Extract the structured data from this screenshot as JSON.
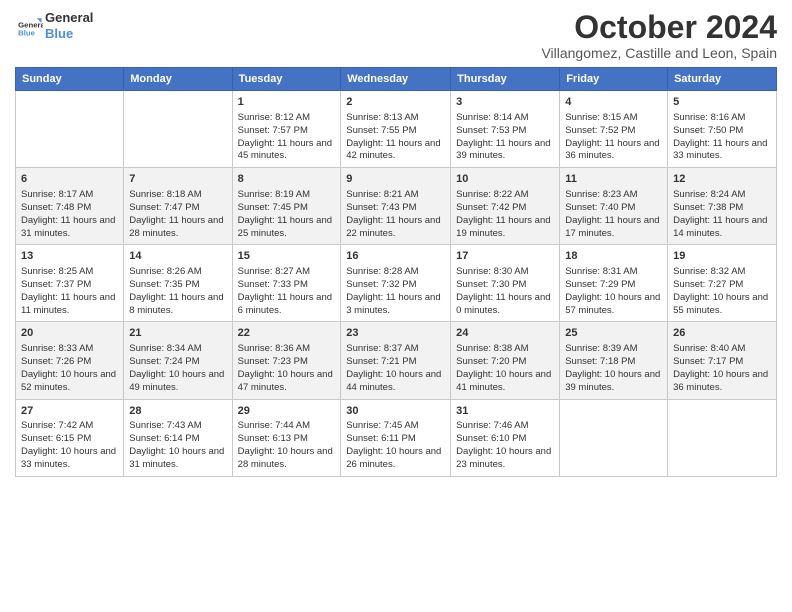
{
  "header": {
    "logo": {
      "line1": "General",
      "line2": "Blue"
    },
    "title": "October 2024",
    "subtitle": "Villangomez, Castille and Leon, Spain"
  },
  "days_of_week": [
    "Sunday",
    "Monday",
    "Tuesday",
    "Wednesday",
    "Thursday",
    "Friday",
    "Saturday"
  ],
  "weeks": [
    [
      {
        "day": "",
        "sunrise": "",
        "sunset": "",
        "daylight": ""
      },
      {
        "day": "",
        "sunrise": "",
        "sunset": "",
        "daylight": ""
      },
      {
        "day": "1",
        "sunrise": "Sunrise: 8:12 AM",
        "sunset": "Sunset: 7:57 PM",
        "daylight": "Daylight: 11 hours and 45 minutes."
      },
      {
        "day": "2",
        "sunrise": "Sunrise: 8:13 AM",
        "sunset": "Sunset: 7:55 PM",
        "daylight": "Daylight: 11 hours and 42 minutes."
      },
      {
        "day": "3",
        "sunrise": "Sunrise: 8:14 AM",
        "sunset": "Sunset: 7:53 PM",
        "daylight": "Daylight: 11 hours and 39 minutes."
      },
      {
        "day": "4",
        "sunrise": "Sunrise: 8:15 AM",
        "sunset": "Sunset: 7:52 PM",
        "daylight": "Daylight: 11 hours and 36 minutes."
      },
      {
        "day": "5",
        "sunrise": "Sunrise: 8:16 AM",
        "sunset": "Sunset: 7:50 PM",
        "daylight": "Daylight: 11 hours and 33 minutes."
      }
    ],
    [
      {
        "day": "6",
        "sunrise": "Sunrise: 8:17 AM",
        "sunset": "Sunset: 7:48 PM",
        "daylight": "Daylight: 11 hours and 31 minutes."
      },
      {
        "day": "7",
        "sunrise": "Sunrise: 8:18 AM",
        "sunset": "Sunset: 7:47 PM",
        "daylight": "Daylight: 11 hours and 28 minutes."
      },
      {
        "day": "8",
        "sunrise": "Sunrise: 8:19 AM",
        "sunset": "Sunset: 7:45 PM",
        "daylight": "Daylight: 11 hours and 25 minutes."
      },
      {
        "day": "9",
        "sunrise": "Sunrise: 8:21 AM",
        "sunset": "Sunset: 7:43 PM",
        "daylight": "Daylight: 11 hours and 22 minutes."
      },
      {
        "day": "10",
        "sunrise": "Sunrise: 8:22 AM",
        "sunset": "Sunset: 7:42 PM",
        "daylight": "Daylight: 11 hours and 19 minutes."
      },
      {
        "day": "11",
        "sunrise": "Sunrise: 8:23 AM",
        "sunset": "Sunset: 7:40 PM",
        "daylight": "Daylight: 11 hours and 17 minutes."
      },
      {
        "day": "12",
        "sunrise": "Sunrise: 8:24 AM",
        "sunset": "Sunset: 7:38 PM",
        "daylight": "Daylight: 11 hours and 14 minutes."
      }
    ],
    [
      {
        "day": "13",
        "sunrise": "Sunrise: 8:25 AM",
        "sunset": "Sunset: 7:37 PM",
        "daylight": "Daylight: 11 hours and 11 minutes."
      },
      {
        "day": "14",
        "sunrise": "Sunrise: 8:26 AM",
        "sunset": "Sunset: 7:35 PM",
        "daylight": "Daylight: 11 hours and 8 minutes."
      },
      {
        "day": "15",
        "sunrise": "Sunrise: 8:27 AM",
        "sunset": "Sunset: 7:33 PM",
        "daylight": "Daylight: 11 hours and 6 minutes."
      },
      {
        "day": "16",
        "sunrise": "Sunrise: 8:28 AM",
        "sunset": "Sunset: 7:32 PM",
        "daylight": "Daylight: 11 hours and 3 minutes."
      },
      {
        "day": "17",
        "sunrise": "Sunrise: 8:30 AM",
        "sunset": "Sunset: 7:30 PM",
        "daylight": "Daylight: 11 hours and 0 minutes."
      },
      {
        "day": "18",
        "sunrise": "Sunrise: 8:31 AM",
        "sunset": "Sunset: 7:29 PM",
        "daylight": "Daylight: 10 hours and 57 minutes."
      },
      {
        "day": "19",
        "sunrise": "Sunrise: 8:32 AM",
        "sunset": "Sunset: 7:27 PM",
        "daylight": "Daylight: 10 hours and 55 minutes."
      }
    ],
    [
      {
        "day": "20",
        "sunrise": "Sunrise: 8:33 AM",
        "sunset": "Sunset: 7:26 PM",
        "daylight": "Daylight: 10 hours and 52 minutes."
      },
      {
        "day": "21",
        "sunrise": "Sunrise: 8:34 AM",
        "sunset": "Sunset: 7:24 PM",
        "daylight": "Daylight: 10 hours and 49 minutes."
      },
      {
        "day": "22",
        "sunrise": "Sunrise: 8:36 AM",
        "sunset": "Sunset: 7:23 PM",
        "daylight": "Daylight: 10 hours and 47 minutes."
      },
      {
        "day": "23",
        "sunrise": "Sunrise: 8:37 AM",
        "sunset": "Sunset: 7:21 PM",
        "daylight": "Daylight: 10 hours and 44 minutes."
      },
      {
        "day": "24",
        "sunrise": "Sunrise: 8:38 AM",
        "sunset": "Sunset: 7:20 PM",
        "daylight": "Daylight: 10 hours and 41 minutes."
      },
      {
        "day": "25",
        "sunrise": "Sunrise: 8:39 AM",
        "sunset": "Sunset: 7:18 PM",
        "daylight": "Daylight: 10 hours and 39 minutes."
      },
      {
        "day": "26",
        "sunrise": "Sunrise: 8:40 AM",
        "sunset": "Sunset: 7:17 PM",
        "daylight": "Daylight: 10 hours and 36 minutes."
      }
    ],
    [
      {
        "day": "27",
        "sunrise": "Sunrise: 7:42 AM",
        "sunset": "Sunset: 6:15 PM",
        "daylight": "Daylight: 10 hours and 33 minutes."
      },
      {
        "day": "28",
        "sunrise": "Sunrise: 7:43 AM",
        "sunset": "Sunset: 6:14 PM",
        "daylight": "Daylight: 10 hours and 31 minutes."
      },
      {
        "day": "29",
        "sunrise": "Sunrise: 7:44 AM",
        "sunset": "Sunset: 6:13 PM",
        "daylight": "Daylight: 10 hours and 28 minutes."
      },
      {
        "day": "30",
        "sunrise": "Sunrise: 7:45 AM",
        "sunset": "Sunset: 6:11 PM",
        "daylight": "Daylight: 10 hours and 26 minutes."
      },
      {
        "day": "31",
        "sunrise": "Sunrise: 7:46 AM",
        "sunset": "Sunset: 6:10 PM",
        "daylight": "Daylight: 10 hours and 23 minutes."
      },
      {
        "day": "",
        "sunrise": "",
        "sunset": "",
        "daylight": ""
      },
      {
        "day": "",
        "sunrise": "",
        "sunset": "",
        "daylight": ""
      }
    ]
  ],
  "colors": {
    "header_bg": "#4472c4",
    "accent": "#4a90d9"
  }
}
